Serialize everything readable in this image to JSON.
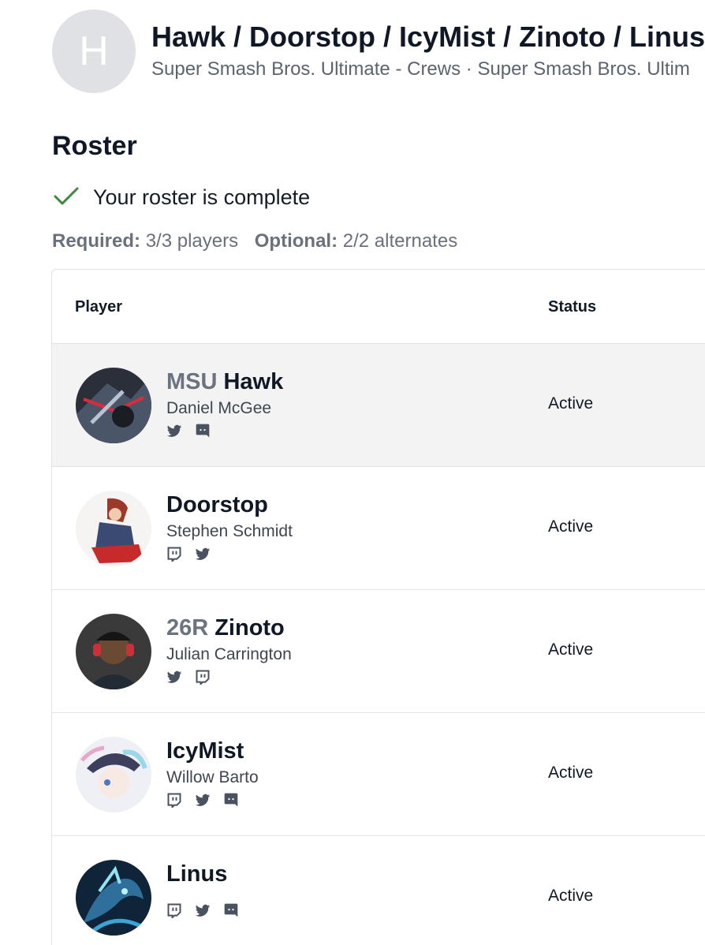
{
  "team": {
    "avatar_letter": "H",
    "title": "Hawk / Doorstop / IcyMist / Zinoto / Linus",
    "subtitle": "Super Smash Bros. Ultimate - Crews · Super Smash Bros. Ultim"
  },
  "roster": {
    "title": "Roster",
    "complete_message": "Your roster is complete",
    "check_color": "#3c8a3c",
    "required_label": "Required:",
    "required_value": "3/3 players",
    "optional_label": "Optional:",
    "optional_value": "2/2 alternates"
  },
  "table": {
    "headers": {
      "player": "Player",
      "status": "Status"
    },
    "rows": [
      {
        "prefix": "MSU",
        "gamertag": "Hawk",
        "name": "Daniel McGee",
        "status": "Active",
        "socials": [
          "twitter-icon",
          "discord-icon"
        ]
      },
      {
        "prefix": "",
        "gamertag": "Doorstop",
        "name": "Stephen Schmidt",
        "status": "Active",
        "socials": [
          "twitch-icon",
          "twitter-icon"
        ]
      },
      {
        "prefix": "26R",
        "gamertag": "Zinoto",
        "name": "Julian Carrington",
        "status": "Active",
        "socials": [
          "twitter-icon",
          "twitch-icon"
        ]
      },
      {
        "prefix": "",
        "gamertag": "IcyMist",
        "name": "Willow Barto",
        "status": "Active",
        "socials": [
          "twitch-icon",
          "twitter-icon",
          "discord-icon"
        ]
      },
      {
        "prefix": "",
        "gamertag": "Linus",
        "name": "",
        "status": "Active",
        "socials": [
          "twitch-icon",
          "twitter-icon",
          "discord-icon"
        ]
      }
    ]
  }
}
